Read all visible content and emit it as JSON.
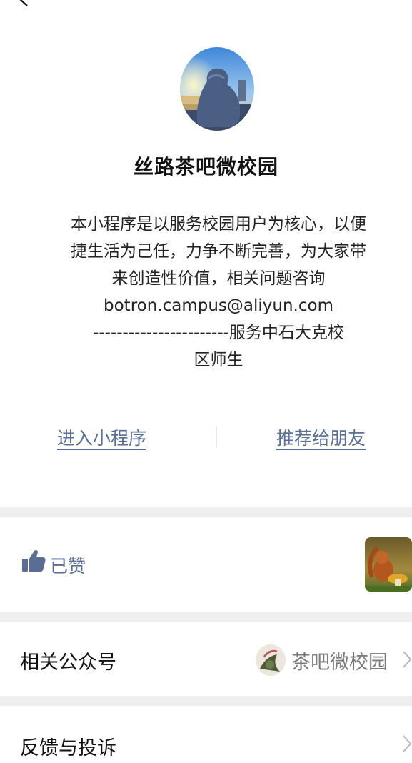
{
  "nav": {
    "back_icon": "chevron-left-icon"
  },
  "profile": {
    "name": "丝路茶吧微校园",
    "description_lines": [
      "本小程序是以服务校园用户为核心，以便",
      "捷生活为己任，力争不断完善，为大家带",
      "来创造性价值，相关问题咨询",
      "botron.campus@aliyun.com",
      "-----------------------服务中石大克校",
      "区师生"
    ]
  },
  "actions": {
    "enter": "进入小程序",
    "recommend": "推荐给朋友"
  },
  "like": {
    "label": "已赞",
    "icon": "thumbs-up-icon"
  },
  "related": {
    "label": "相关公众号",
    "account_name": "茶吧微校园"
  },
  "feedback": {
    "label": "反馈与投诉"
  },
  "colors": {
    "link": "#5a6e93",
    "separator": "#efefef",
    "muted": "#7a7a7a"
  }
}
